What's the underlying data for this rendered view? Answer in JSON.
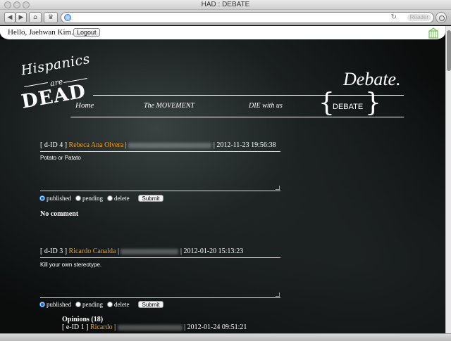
{
  "window": {
    "title": "HAD : DEBATE"
  },
  "toolbar": {
    "reader_label": "Reader"
  },
  "adminbar": {
    "greeting": "Hello, Jaehwan Kim. |",
    "logout_label": "Logout"
  },
  "logo": {
    "line1": "Hispanics",
    "line2": "are",
    "line3": "DEAD"
  },
  "page_title": "Debate.",
  "nav": {
    "home": "Home",
    "movement": "The MOVEMENT",
    "die": "DIE with us",
    "debate": "DEBATE"
  },
  "posts": [
    {
      "id_label": "[ d-ID 4 ]",
      "author": "Rebeca Ana Olvera",
      "separator": "|",
      "timestamp": "| 2012-11-23 19:56:38",
      "body": "Potato or Patato",
      "status_options": [
        "published",
        "pending",
        "delete"
      ],
      "selected_status": "published",
      "submit_label": "Submit",
      "comment_note": "No comment"
    },
    {
      "id_label": "[ d-ID 3 ]",
      "author": "Ricardo Canalda",
      "separator": "|",
      "timestamp": "| 2012-01-20 15:13:23",
      "body": "Kill your own stereotype.",
      "status_options": [
        "published",
        "pending",
        "delete"
      ],
      "selected_status": "published",
      "submit_label": "Submit",
      "opinions_label": "Opinions (18)",
      "opinion": {
        "id_label": "[ e-ID 1 ]",
        "author": "Ricardo",
        "separator": "|",
        "timestamp": "| 2012-01-24 09:51:21"
      }
    }
  ],
  "colors": {
    "author": "#f0a020",
    "background": "#0b0d0d",
    "text": "#ffffff"
  }
}
